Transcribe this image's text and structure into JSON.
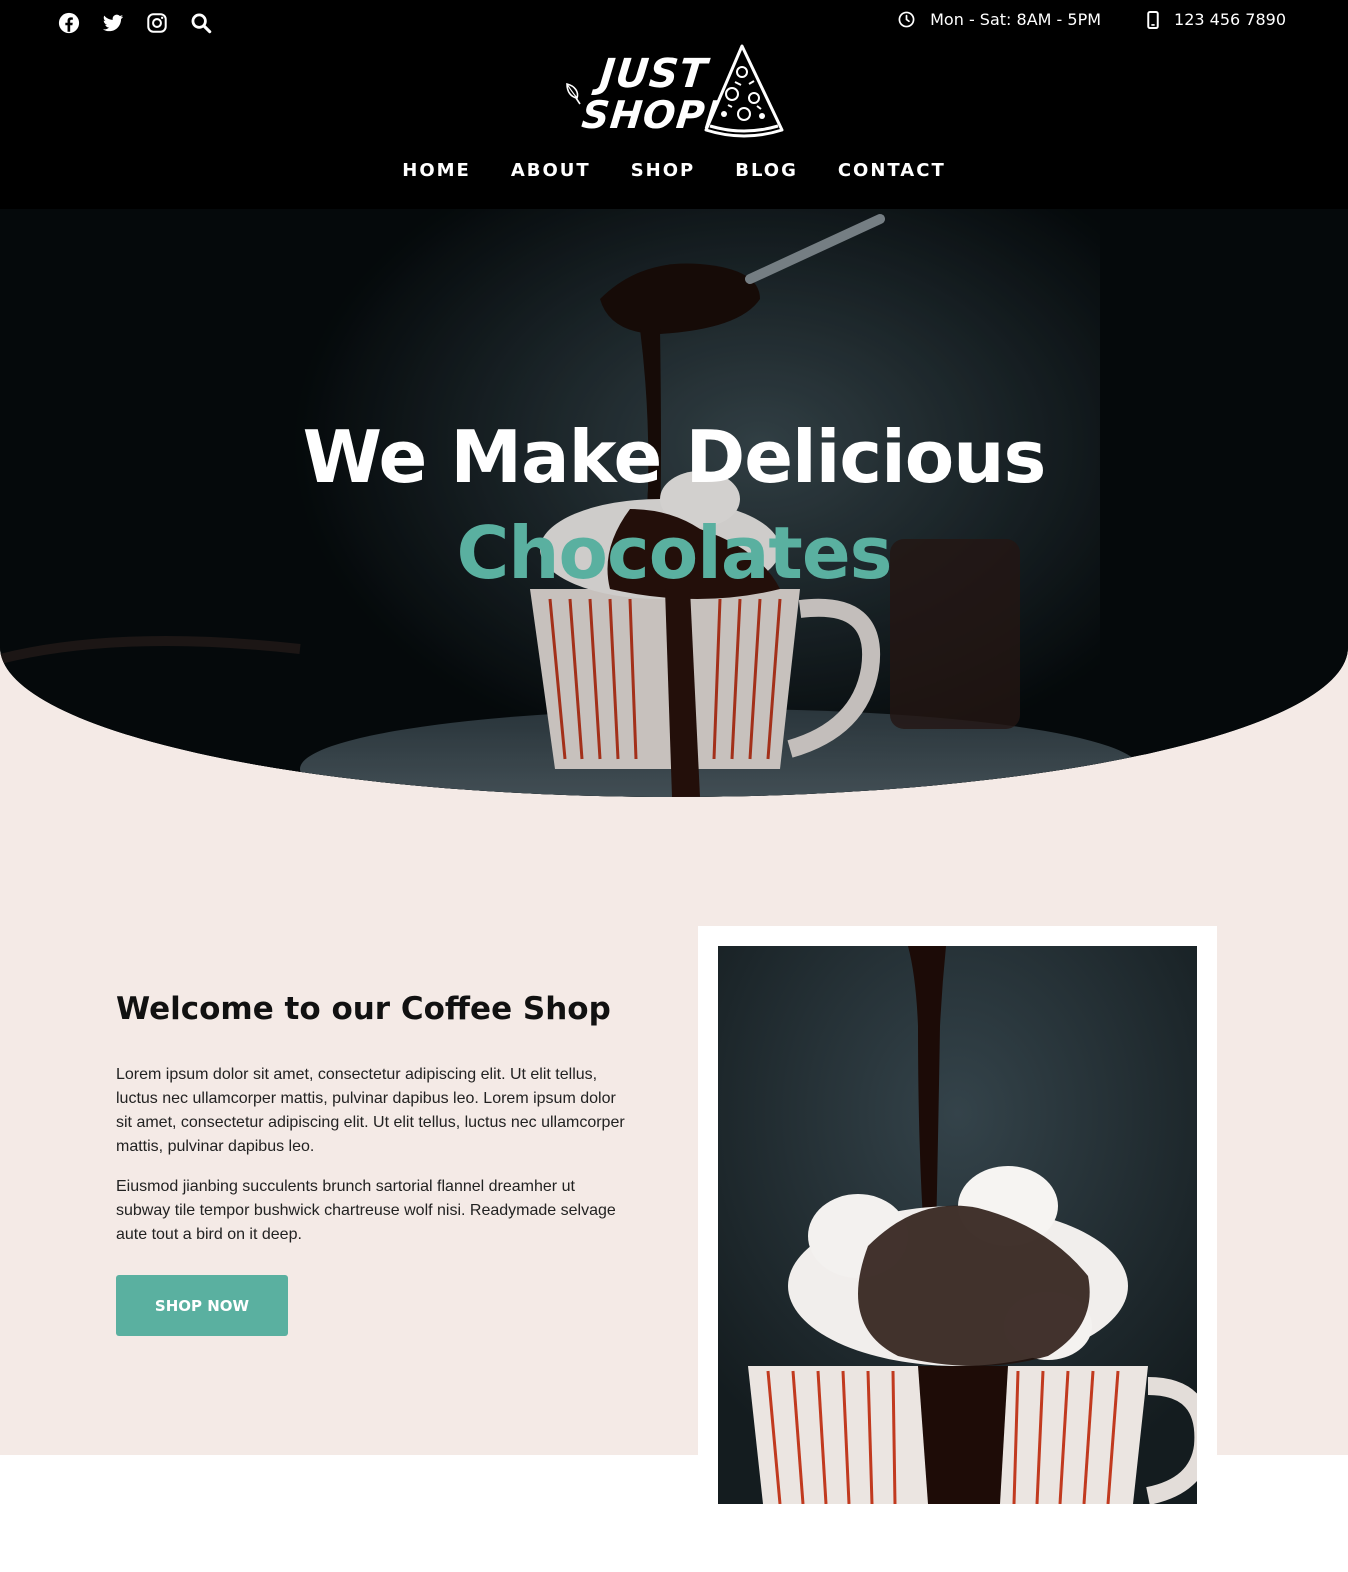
{
  "header": {
    "social": [
      {
        "name": "facebook-icon"
      },
      {
        "name": "twitter-icon"
      },
      {
        "name": "instagram-icon"
      },
      {
        "name": "search-icon"
      }
    ],
    "hours_icon": "clock-icon",
    "hours": "Mon - Sat: 8AM - 5PM",
    "phone_icon": "phone-icon",
    "phone": "123 456 7890",
    "logo": {
      "line1": "JUST",
      "line2": "SHOPPE"
    }
  },
  "nav": {
    "items": [
      "HOME",
      "ABOUT",
      "SHOP",
      "BLOG",
      "CONTACT"
    ]
  },
  "hero": {
    "title": "We Make Delicious",
    "accent": "Chocolates"
  },
  "welcome": {
    "title": "Welcome to our Coffee Shop",
    "para1": "Lorem ipsum dolor sit amet, consectetur adipiscing elit. Ut elit tellus, luctus nec ullamcorper mattis, pulvinar dapibus leo. Lorem ipsum dolor sit amet, consectetur adipiscing elit. Ut elit tellus, luctus nec ullamcorper mattis, pulvinar dapibus leo.",
    "para2": "Eiusmod jianbing succulents brunch sartorial flannel dreamher ut subway tile tempor bushwick chartreuse wolf nisi. Readymade selvage aute tout a bird on it deep.",
    "button": "SHOP NOW"
  },
  "colors": {
    "accent": "#5ab0a0",
    "header_bg": "#000000",
    "section_bg": "#f4eae6"
  }
}
